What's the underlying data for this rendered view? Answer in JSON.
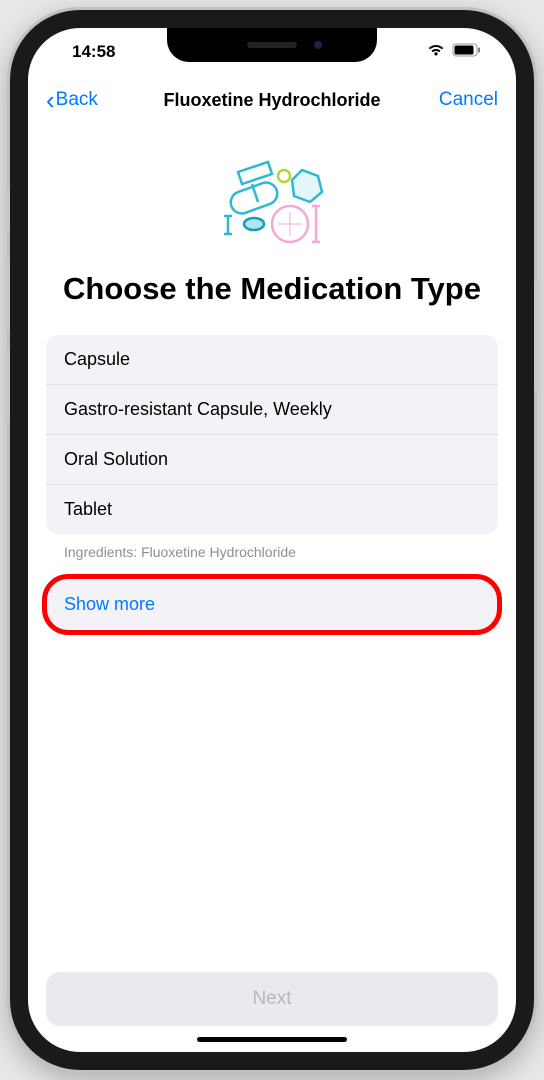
{
  "status": {
    "time": "14:58"
  },
  "nav": {
    "back_label": "Back",
    "title": "Fluoxetine Hydrochloride",
    "cancel_label": "Cancel"
  },
  "main": {
    "heading": "Choose the Medication Type",
    "options": [
      "Capsule",
      "Gastro-resistant Capsule, Weekly",
      "Oral Solution",
      "Tablet"
    ],
    "ingredients_label": "Ingredients:",
    "ingredients_value": "Fluoxetine Hydrochloride",
    "show_more_label": "Show more",
    "next_label": "Next"
  },
  "colors": {
    "accent": "#007aff",
    "highlight": "#ff0000"
  }
}
